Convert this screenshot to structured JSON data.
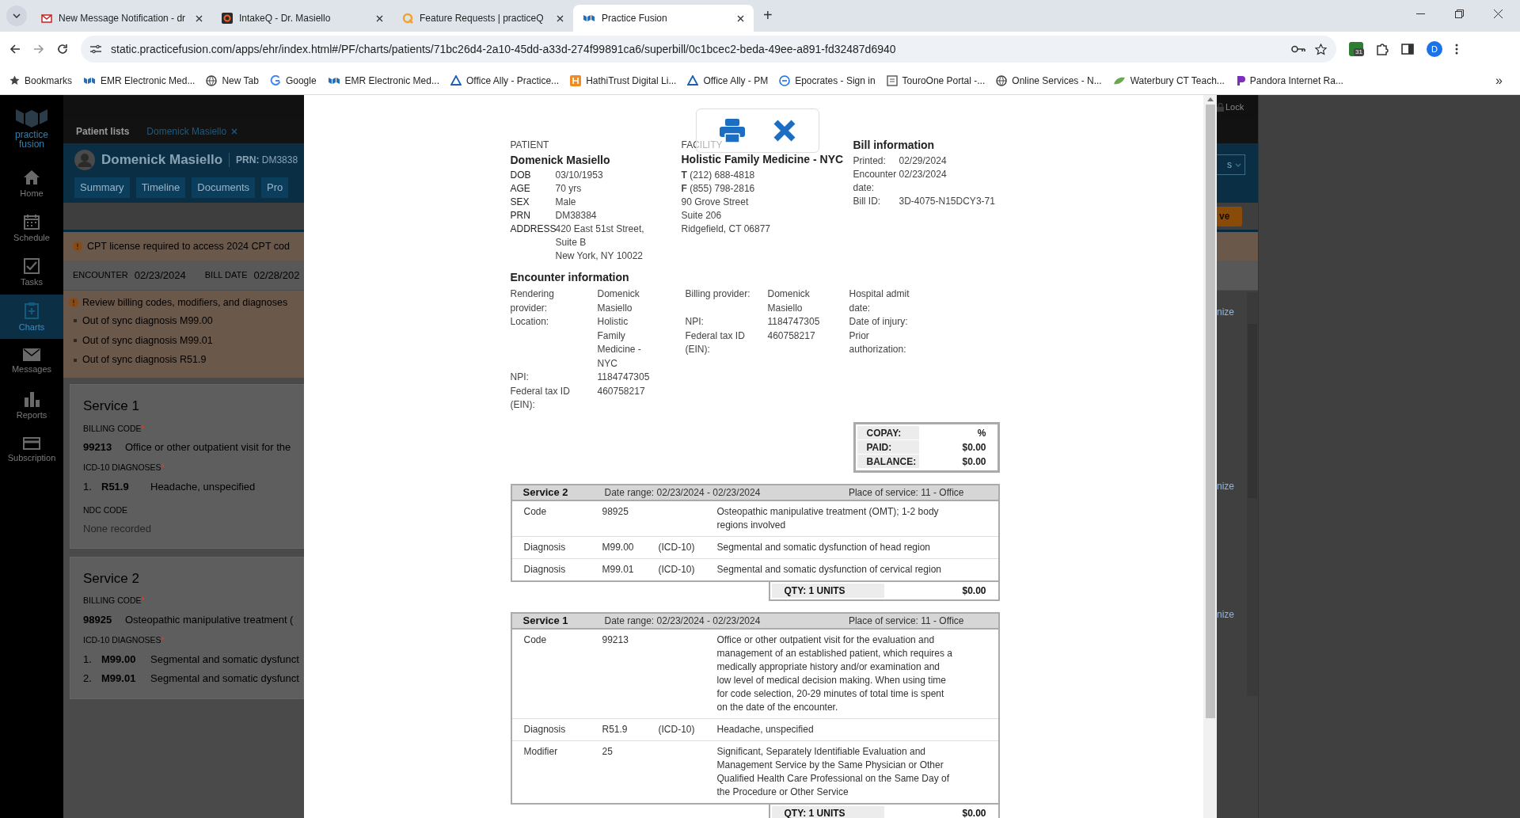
{
  "browser": {
    "tabs": [
      {
        "kind": "envelope",
        "title": "New Message Notification - dr",
        "selected": false
      },
      {
        "kind": "square",
        "title": "IntakeQ - Dr. Masiello",
        "selected": false
      },
      {
        "kind": "ring",
        "title": "Feature Requests | practiceQ",
        "selected": false
      },
      {
        "kind": "cubes",
        "title": "Practice Fusion",
        "selected": true
      }
    ],
    "new_tab": "+",
    "url": "static.practicefusion.com/apps/ehr/index.html#/PF/charts/patients/71bc26d4-2a10-45dd-a33d-274f99891ca6/superbill/0c1bcec2-beda-49ee-a891-fd32487d6940",
    "extension_badge": "31",
    "profile": "D",
    "bookmarks": [
      {
        "kind": "star",
        "label": "Bookmarks"
      },
      {
        "kind": "cubes",
        "label": "EMR Electronic Med..."
      },
      {
        "kind": "globe",
        "label": "New Tab"
      },
      {
        "kind": "g",
        "label": "Google"
      },
      {
        "kind": "cubes",
        "label": "EMR Electronic Med..."
      },
      {
        "kind": "triangle",
        "label": "Office Ally - Practice..."
      },
      {
        "kind": "tile",
        "label": "HathiTrust Digital Li..."
      },
      {
        "kind": "triangle",
        "label": "Office Ally - PM"
      },
      {
        "kind": "circle",
        "label": "Epocrates - Sign in"
      },
      {
        "kind": "page",
        "label": "TouroOne Portal -..."
      },
      {
        "kind": "globe",
        "label": "Online Services - N..."
      },
      {
        "kind": "leaf",
        "label": "Waterbury CT Teach..."
      },
      {
        "kind": "flag",
        "label": "Pandora Internet Ra..."
      }
    ],
    "more": "»"
  },
  "app": {
    "logo": [
      "practice",
      "fusion"
    ],
    "sidebar": [
      {
        "kind": "home",
        "label": "Home",
        "selected": false
      },
      {
        "kind": "calendar",
        "label": "Schedule",
        "selected": false
      },
      {
        "kind": "check",
        "label": "Tasks",
        "selected": false
      },
      {
        "kind": "clipboard",
        "label": "Charts",
        "selected": true
      },
      {
        "kind": "envelope",
        "label": "Messages",
        "selected": false
      },
      {
        "kind": "bars",
        "label": "Reports",
        "selected": false
      },
      {
        "kind": "card",
        "label": "Subscription",
        "selected": false
      }
    ],
    "breadcrumb_tabs": [
      {
        "label": "Patient lists",
        "selected": false
      },
      {
        "label": "Domenick Masiello",
        "selected": true
      }
    ],
    "patient_name": "Domenick Masiello",
    "prn": "**PRN:** DM3838",
    "chart_tabs": [
      "Summary",
      "Timeline",
      "Documents",
      "Pro"
    ],
    "cpt_alert": "CPT license required to access 2024 CPT cod",
    "encounter_bar": [
      {
        "label": "ENCOUNTER",
        "value": "02/23/2024"
      },
      {
        "label": "BILL DATE",
        "value": "02/28/202"
      }
    ],
    "review_alert": {
      "text": "Review billing codes, modifiers, and diagnoses",
      "items": [
        "Out of sync diagnosis M99.00",
        "Out of sync diagnosis M99.01",
        "Out of sync diagnosis R51.9"
      ]
    },
    "service_cards": [
      {
        "title": "Service 1",
        "billing_label": "BILLING CODE",
        "required_mark": "*",
        "code": "99213",
        "code_text": "Office or other outpatient visit for the",
        "diagnoses_label": "ICD-10 DIAGNOSES",
        "diagnoses": [
          {
            "number": "1.",
            "code": "R51.9",
            "text": "Headache, unspecified"
          }
        ],
        "ndc_label": "NDC CODE",
        "ndc_value": "None recorded"
      },
      {
        "title": "Service 2",
        "billing_label": "BILLING CODE",
        "required_mark": "*",
        "code": "98925",
        "code_text": "Osteopathic manipulative treatment (",
        "diagnoses_label": "ICD-10 DIAGNOSES",
        "diagnoses": [
          {
            "number": "1.",
            "code": "M99.00",
            "text": "Segmental and somatic dysfunct"
          },
          {
            "number": "2.",
            "code": "M99.01",
            "text": "Segmental and somatic dysfunct"
          }
        ]
      }
    ],
    "right_edge": {
      "lock": "Lock",
      "dropdown": "s",
      "button": "ve",
      "links": [
        "nize",
        "nize",
        "nize"
      ]
    }
  },
  "bill": {
    "patient": {
      "heading": "PATIENT",
      "name": "Domenick Masiello",
      "fields": [
        {
          "label": "DOB",
          "lines": [
            "03/10/1953"
          ]
        },
        {
          "label": "AGE",
          "lines": [
            "70 yrs"
          ]
        },
        {
          "label": "SEX",
          "lines": [
            "Male"
          ]
        },
        {
          "label": "PRN",
          "lines": [
            "DM38384"
          ]
        },
        {
          "label": "ADDRESS",
          "lines": [
            "420 East 51st Street,",
            "Suite B",
            "New York, NY 10022"
          ]
        }
      ]
    },
    "facility": {
      "heading": "FACILITY",
      "name": "Holistic Family Medicine - NYC",
      "lines": [
        "**T** (212) 688-4818",
        "**F** (855) 798-2816",
        "90 Grove Street",
        "Suite 206",
        "Ridgefield, CT 06877"
      ]
    },
    "bill_info": {
      "title": "Bill information",
      "fields": [
        {
          "label": "Printed:",
          "value": "02/29/2024"
        },
        {
          "label": "Encounter date:",
          "value": "02/23/2024"
        },
        {
          "label": "Bill ID:",
          "value": "3D-4075-N15DCY3-71"
        }
      ]
    },
    "encounter": {
      "title": "Encounter information",
      "columns": [
        [
          {
            "label": "Rendering provider:",
            "value": "Domenick Masiello"
          },
          {
            "label": "Location:",
            "value": "Holistic Family Medicine - NYC"
          },
          {
            "label": "NPI:",
            "value": "1184747305"
          },
          {
            "label": "Federal tax ID (EIN):",
            "value": "460758217"
          }
        ],
        [
          {
            "label": "Billing provider:",
            "value": "Domenick Masiello"
          },
          {
            "label": "NPI:",
            "value": "1184747305"
          },
          {
            "label": "Federal tax ID (EIN):",
            "value": "460758217"
          }
        ],
        [
          {
            "label": "Hospital admit date:"
          },
          {
            "label": "Date of injury:"
          },
          {
            "label": "Prior authorization:"
          }
        ]
      ]
    },
    "totals": [
      {
        "label": "COPAY:",
        "value": "%"
      },
      {
        "label": "PAID:",
        "value": "$0.00"
      },
      {
        "label": "BALANCE:",
        "value": "$0.00"
      }
    ],
    "services": [
      {
        "title": "Service 2",
        "date_range": "Date range: 02/23/2024 - 02/23/2024",
        "place": "Place of service: 11 - Office",
        "rows": [
          {
            "label": "Code",
            "code": "98925",
            "description": "Osteopathic manipulative treatment (OMT); 1-2 body regions involved"
          },
          {
            "label": "Diagnosis",
            "code": "M99.00",
            "system": "(ICD-10)",
            "description": "Segmental and somatic dysfunction of head region"
          },
          {
            "label": "Diagnosis",
            "code": "M99.01",
            "system": "(ICD-10)",
            "description": "Segmental and somatic dysfunction of cervical region"
          }
        ],
        "qty": "QTY: 1 UNITS",
        "amount": "$0.00"
      },
      {
        "title": "Service 1",
        "date_range": "Date range: 02/23/2024 - 02/23/2024",
        "place": "Place of service: 11 - Office",
        "rows": [
          {
            "label": "Code",
            "code": "99213",
            "description": "Office or other outpatient visit for the evaluation and management of an established patient, which requires a medically appropriate history and/or examination and low level of medical decision making. When using time for code selection, 20-29 minutes of total time is spent on the date of the encounter."
          },
          {
            "label": "Diagnosis",
            "code": "R51.9",
            "system": "(ICD-10)",
            "description": "Headache, unspecified"
          },
          {
            "label": "Modifier",
            "code": "25",
            "description": "Significant, Separately Identifiable Evaluation and Management Service by the Same Physician or Other Qualified Health Care Professional on the Same Day of the Procedure or Other Service"
          }
        ],
        "qty": "QTY: 1 UNITS",
        "amount": "$0.00"
      }
    ]
  }
}
